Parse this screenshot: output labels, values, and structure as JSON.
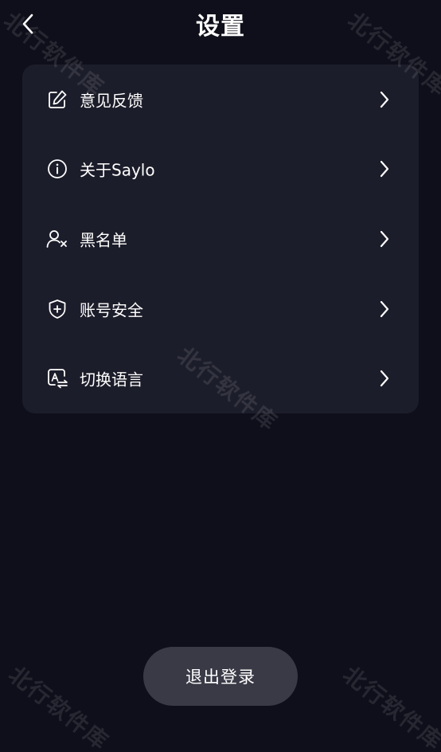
{
  "header": {
    "title": "设置",
    "back_icon": "chevron-left-icon"
  },
  "settings": {
    "items": [
      {
        "label": "意见反馈",
        "icon": "edit-icon"
      },
      {
        "label": "关于Saylo",
        "icon": "info-icon"
      },
      {
        "label": "黑名单",
        "icon": "user-block-icon"
      },
      {
        "label": "账号安全",
        "icon": "shield-plus-icon"
      },
      {
        "label": "切换语言",
        "icon": "translate-icon"
      }
    ]
  },
  "logout": {
    "label": "退出登录"
  },
  "watermark": {
    "text": "北行软件库"
  },
  "colors": {
    "background": "#0e0f1a",
    "card": "#1c1d2a",
    "button": "#3a3a47",
    "text": "#ffffff"
  }
}
